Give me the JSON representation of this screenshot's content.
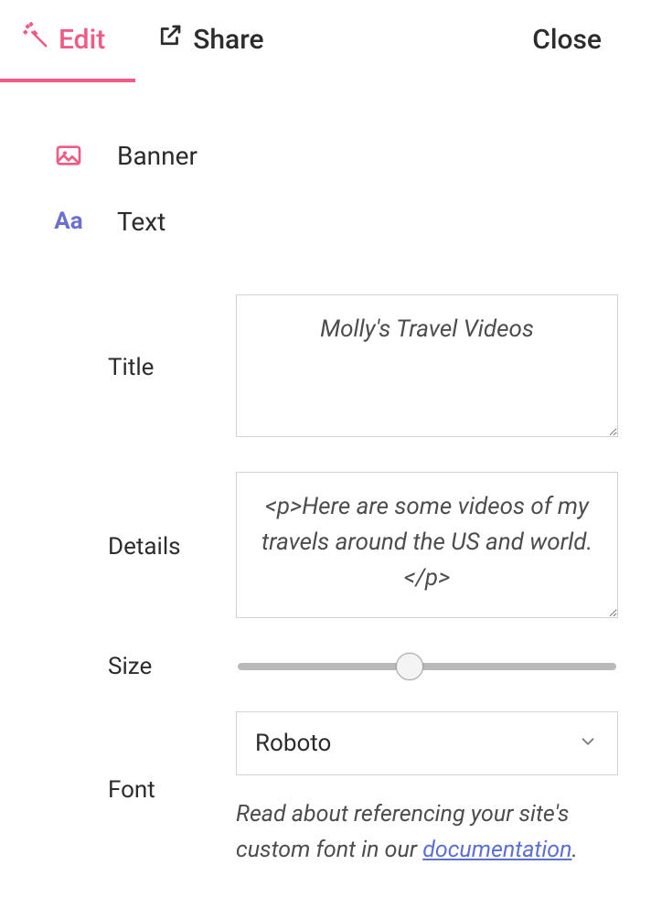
{
  "tabs": {
    "edit": "Edit",
    "share": "Share",
    "close": "Close"
  },
  "sections": {
    "banner": "Banner",
    "text": "Text"
  },
  "form": {
    "title_label": "Title",
    "title_value": "Molly's Travel Videos",
    "details_label": "Details",
    "details_value": "<p>Here are some videos of my travels around the US and world.</p>",
    "size_label": "Size",
    "size_value": 45,
    "size_min": 0,
    "size_max": 100,
    "font_label": "Font",
    "font_value": "Roboto",
    "helper_prefix": "Read about referencing your site's custom font in our ",
    "helper_link": "documentation",
    "helper_suffix": "."
  },
  "colors": {
    "accent": "#ef5b84",
    "text_icon": "#6b6fd1"
  }
}
